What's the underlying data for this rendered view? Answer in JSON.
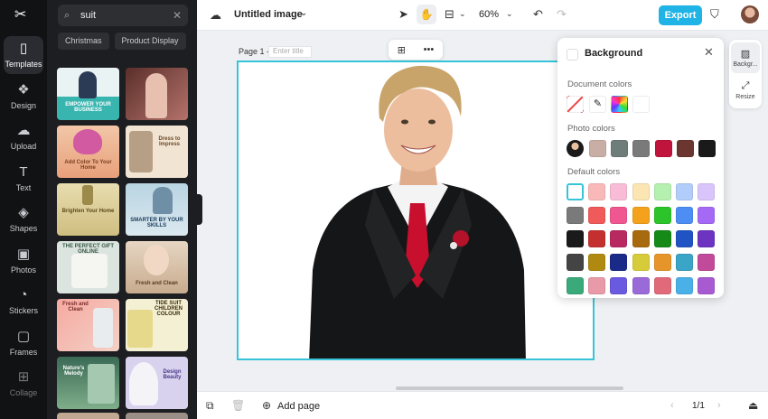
{
  "app": {
    "logo": "capcut-logo"
  },
  "rail": {
    "items": [
      {
        "label": "Templates",
        "icon": "templates-icon",
        "active": true
      },
      {
        "label": "Design",
        "icon": "design-icon"
      },
      {
        "label": "Upload",
        "icon": "upload-icon"
      },
      {
        "label": "Text",
        "icon": "text-icon"
      },
      {
        "label": "Shapes",
        "icon": "shapes-icon"
      },
      {
        "label": "Photos",
        "icon": "photos-icon"
      },
      {
        "label": "Stickers",
        "icon": "stickers-icon"
      },
      {
        "label": "Frames",
        "icon": "frames-icon"
      },
      {
        "label": "Collage",
        "icon": "collage-icon"
      }
    ]
  },
  "panel": {
    "search_value": "suit",
    "chips": [
      "Christmas",
      "Product Display"
    ],
    "thumbs": [
      {
        "text": "EMPOWER YOUR BUSINESS"
      },
      {
        "text": ""
      },
      {
        "text": "Add Color To Your Home"
      },
      {
        "text": "Dress to Impress"
      },
      {
        "text": "Brighten Your Home"
      },
      {
        "text": "SMARTER BY YOUR SKILLS"
      },
      {
        "text": "THE PERFECT GIFT ONLINE"
      },
      {
        "text": "Fresh and Clean"
      },
      {
        "text": "Fresh and Clean"
      },
      {
        "text": "TIDE SUIT CHILDREN COLOUR"
      },
      {
        "text": "Nature's Melody"
      },
      {
        "text": "Design Beauty"
      }
    ]
  },
  "topbar": {
    "title": "Untitled image",
    "zoom": "60%",
    "export_label": "Export"
  },
  "canvas": {
    "page_label": "Page 1 -",
    "title_placeholder": "Enter title"
  },
  "bottombar": {
    "add_page_label": "Add page",
    "page_count": "1/1"
  },
  "background_panel": {
    "title": "Background",
    "document_label": "Document colors",
    "photo_label": "Photo colors",
    "default_label": "Default colors",
    "photo_colors": [
      "#c9aea5",
      "#6f7d7a",
      "#7a7a7a",
      "#c0143c",
      "#6b3530",
      "#1a1a1a"
    ],
    "default_colors": [
      [
        "#ffffff",
        "#f9b9b9",
        "#f8bcd6",
        "#fbe6b3",
        "#b6f0b0",
        "#b3cdfa",
        "#d9c5fa"
      ],
      [
        "#7a7a7a",
        "#f05a5a",
        "#f0568f",
        "#f4a21c",
        "#2cc42a",
        "#4d8ef5",
        "#a46af5"
      ],
      [
        "#1a1a1a",
        "#c4302f",
        "#b8295f",
        "#a86a0e",
        "#158a17",
        "#2054c4",
        "#6c34c0"
      ],
      [
        "#444444",
        "#b08a10",
        "#1a2a88",
        "#d6cc3a",
        "#e6952a",
        "#3aa5c6",
        "#c24a9a"
      ],
      [
        "#3aaa7a",
        "#e89aa8",
        "#6a5ae0",
        "#9a6ad8",
        "#e06a7a",
        "#4ab0e8",
        "#a85ad0"
      ]
    ]
  },
  "dock": {
    "items": [
      {
        "label": "Backgr...",
        "icon": "background-icon"
      },
      {
        "label": "Resize",
        "icon": "resize-icon"
      }
    ]
  }
}
